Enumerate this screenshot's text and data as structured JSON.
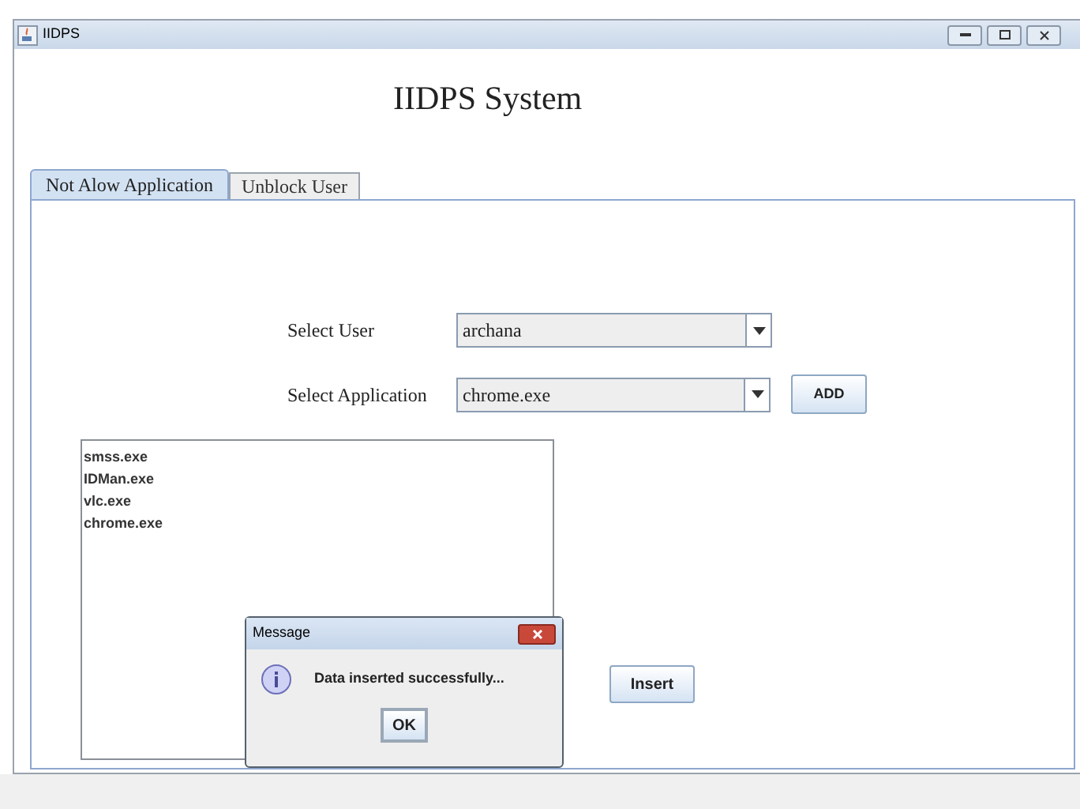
{
  "window": {
    "title": "IIDPS"
  },
  "heading": "IIDPS System",
  "tabs": [
    {
      "label": "Not Alow Application",
      "selected": true
    },
    {
      "label": "Unblock User",
      "selected": false
    }
  ],
  "form": {
    "user_label": "Select User",
    "user_value": "archana",
    "app_label": "Select Application",
    "app_value": "chrome.exe",
    "add_button": "ADD"
  },
  "list": [
    "smss.exe",
    "IDMan.exe",
    "vlc.exe",
    "chrome.exe"
  ],
  "insert_button": "Insert",
  "dialog": {
    "title": "Message",
    "message": "Data inserted successfully...",
    "ok_button": "OK"
  }
}
